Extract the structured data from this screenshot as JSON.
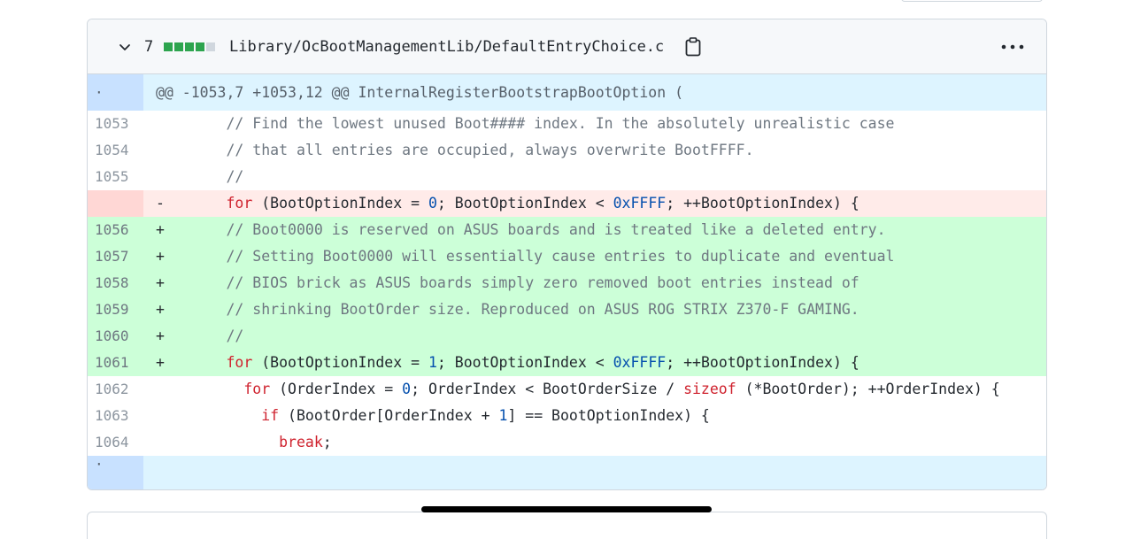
{
  "file": {
    "changes_count": "7",
    "diffstat": {
      "added_blocks": 4,
      "neutral_blocks": 1,
      "added_color": "#2da44e",
      "neutral_color": "#d0d7de"
    },
    "path": "Library/OcBootManagementLib/DefaultEntryChoice.c",
    "icons": {
      "expand": "chevron-down-icon",
      "copy": "clipboard-icon",
      "more": "kebab-horizontal-icon"
    }
  },
  "diff": {
    "hunk_gutter": "·",
    "hunk_header": "@@ -1053,7 +1053,12 @@ InternalRegisterBootstrapBootOption (",
    "lines": [
      {
        "type": "context",
        "line": "1053",
        "segments": [
          [
            "",
            "        "
          ],
          [
            "cmt",
            "// Find the lowest unused Boot#### index. In the absolutely unrealistic case"
          ]
        ]
      },
      {
        "type": "context",
        "line": "1054",
        "segments": [
          [
            "",
            "        "
          ],
          [
            "cmt",
            "// that all entries are occupied, always overwrite BootFFFF."
          ]
        ]
      },
      {
        "type": "context",
        "line": "1055",
        "segments": [
          [
            "",
            "        "
          ],
          [
            "cmt",
            "//"
          ]
        ]
      },
      {
        "type": "deletion",
        "line": "",
        "segments": [
          [
            "",
            "-       "
          ],
          [
            "kw",
            "for"
          ],
          [
            "",
            " (BootOptionIndex = "
          ],
          [
            "num",
            "0"
          ],
          [
            "",
            "; BootOptionIndex < "
          ],
          [
            "num",
            "0xFFFF"
          ],
          [
            "",
            "; ++BootOptionIndex) {"
          ]
        ]
      },
      {
        "type": "addition",
        "line": "1056",
        "segments": [
          [
            "",
            "+       "
          ],
          [
            "cmt",
            "// Boot0000 is reserved on ASUS boards and is treated like a deleted entry."
          ]
        ]
      },
      {
        "type": "addition",
        "line": "1057",
        "segments": [
          [
            "",
            "+       "
          ],
          [
            "cmt",
            "// Setting Boot0000 will essentially cause entries to duplicate and eventual"
          ]
        ]
      },
      {
        "type": "addition",
        "line": "1058",
        "segments": [
          [
            "",
            "+       "
          ],
          [
            "cmt",
            "// BIOS brick as ASUS boards simply zero removed boot entries instead of"
          ]
        ]
      },
      {
        "type": "addition",
        "line": "1059",
        "segments": [
          [
            "",
            "+       "
          ],
          [
            "cmt",
            "// shrinking BootOrder size. Reproduced on ASUS ROG STRIX Z370-F GAMING."
          ]
        ]
      },
      {
        "type": "addition",
        "line": "1060",
        "segments": [
          [
            "",
            "+       "
          ],
          [
            "cmt",
            "//"
          ]
        ]
      },
      {
        "type": "addition",
        "line": "1061",
        "segments": [
          [
            "",
            "+       "
          ],
          [
            "kw",
            "for"
          ],
          [
            "",
            " (BootOptionIndex = "
          ],
          [
            "num",
            "1"
          ],
          [
            "",
            "; BootOptionIndex < "
          ],
          [
            "num",
            "0xFFFF"
          ],
          [
            "",
            "; ++BootOptionIndex) {"
          ]
        ]
      },
      {
        "type": "context",
        "line": "1062",
        "segments": [
          [
            "",
            "          "
          ],
          [
            "kw",
            "for"
          ],
          [
            "",
            " (OrderIndex = "
          ],
          [
            "num",
            "0"
          ],
          [
            "",
            "; OrderIndex < BootOrderSize / "
          ],
          [
            "kw",
            "sizeof"
          ],
          [
            "",
            " (*BootOrder); ++OrderIndex) {"
          ]
        ]
      },
      {
        "type": "context",
        "line": "1063",
        "segments": [
          [
            "",
            "            "
          ],
          [
            "kw",
            "if"
          ],
          [
            "",
            " (BootOrder[OrderIndex + "
          ],
          [
            "num",
            "1"
          ],
          [
            "",
            "] == BootOptionIndex) {"
          ]
        ]
      },
      {
        "type": "context",
        "line": "1064",
        "segments": [
          [
            "",
            "              "
          ],
          [
            "kw",
            "break"
          ],
          [
            "",
            ";"
          ]
        ]
      }
    ],
    "footer_gutter": "·"
  }
}
